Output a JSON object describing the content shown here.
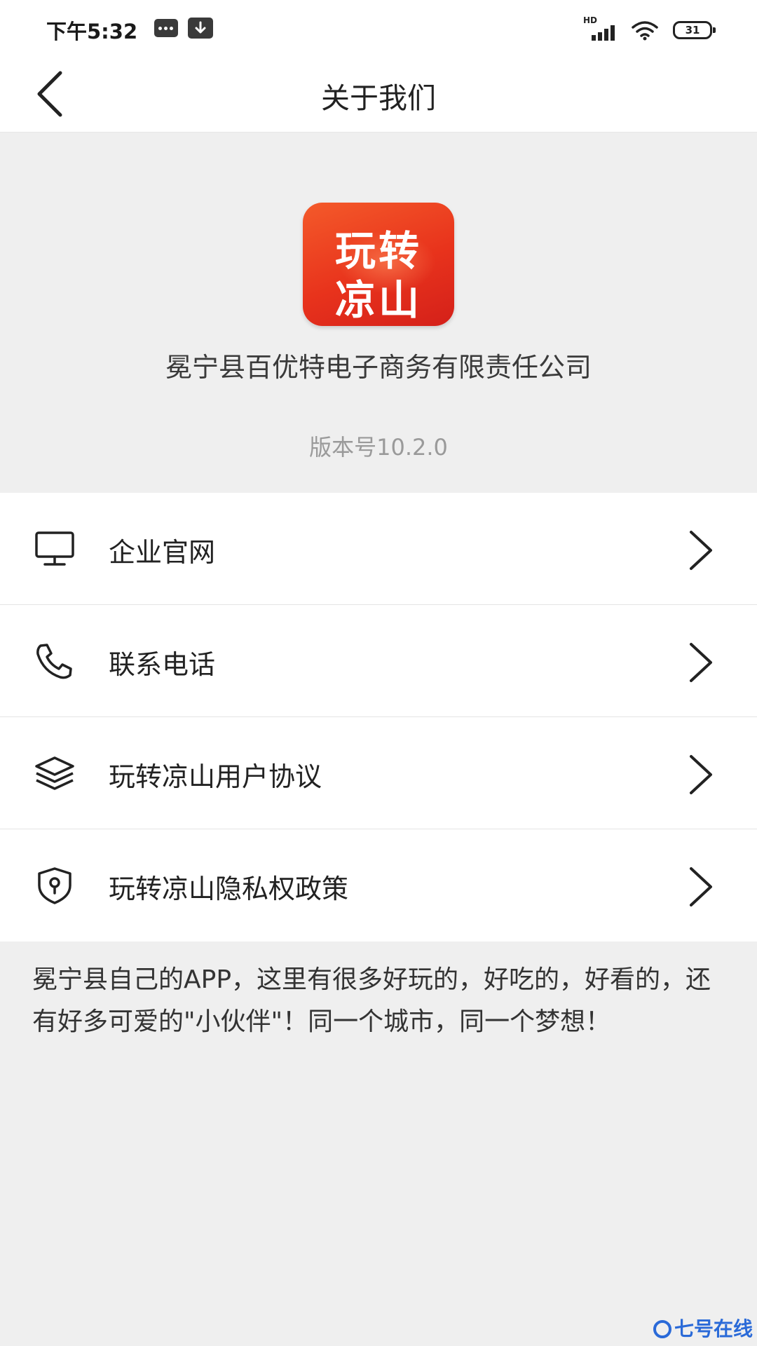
{
  "status_bar": {
    "time": "下午5:32",
    "network_label": "HD",
    "battery": "31"
  },
  "nav": {
    "title": "关于我们"
  },
  "about": {
    "logo_line1": "玩转",
    "logo_line2": "凉山",
    "company": "冕宁县百优特电子商务有限责任公司",
    "version": "版本号10.2.0"
  },
  "menu": {
    "items": [
      {
        "label": "企业官网",
        "icon": "monitor-icon"
      },
      {
        "label": "联系电话",
        "icon": "phone-icon"
      },
      {
        "label": "玩转凉山用户协议",
        "icon": "layers-icon"
      },
      {
        "label": "玩转凉山隐私权政策",
        "icon": "shield-icon"
      }
    ]
  },
  "description": "冕宁县自己的APP，这里有很多好玩的，好吃的，好看的，还有好多可爱的\"小伙伴\"！同一个城市，同一个梦想！",
  "watermark": "七号在线",
  "colors": {
    "logo_red": "#e8331c",
    "background": "#efefef",
    "watermark_blue": "#2a6ad8"
  }
}
